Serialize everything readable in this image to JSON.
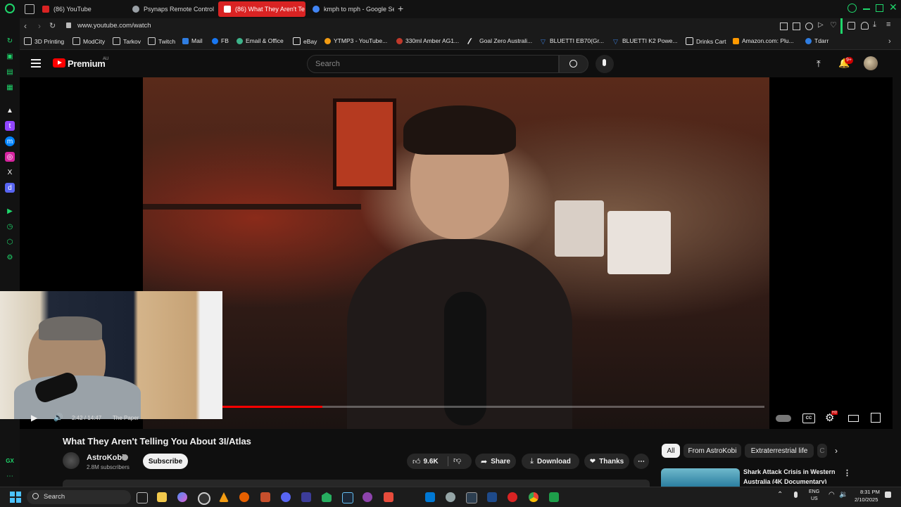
{
  "browser": {
    "tabs": [
      {
        "label": "(86) YouTube",
        "color": "#d92323"
      },
      {
        "label": "Psynaps Remote Control",
        "color": "#9aa0a6"
      },
      {
        "label": "(86) What They Aren't Te",
        "color": "#ffffff"
      },
      {
        "label": "kmph to mph - Google Se",
        "color": "#4285f4"
      }
    ],
    "new_tab": "+",
    "url": "www.youtube.com/watch",
    "bookmarks": [
      {
        "label": "3D Printing",
        "color": "#cfcfcf"
      },
      {
        "label": "ModCity",
        "color": "#cfcfcf"
      },
      {
        "label": "Tarkov",
        "color": "#cfcfcf"
      },
      {
        "label": "Twitch",
        "color": "#cfcfcf"
      },
      {
        "label": "Mail",
        "color": "#2f7de1"
      },
      {
        "label": "FB",
        "color": "#1877f2"
      },
      {
        "label": "Email & Office",
        "color": "#3db38a"
      },
      {
        "label": "eBay",
        "color": "#e6e6e6"
      },
      {
        "label": "YTMP3 - YouTube...",
        "color": "#f39c12"
      },
      {
        "label": "330ml Amber AG1...",
        "color": "#c0392b"
      },
      {
        "label": "Goal Zero Australi...",
        "color": "#e6e6e6"
      },
      {
        "label": "BLUETTI EB70(Gr...",
        "color": "#3a7bd5"
      },
      {
        "label": "BLUETTI K2 Powe...",
        "color": "#3a7bd5"
      },
      {
        "label": "Drinks Cart",
        "color": "#e6e6e6"
      },
      {
        "label": "Amazon.com: Plu...",
        "color": "#ff9900"
      },
      {
        "label": "Tdarr",
        "color": "#2f7de1"
      }
    ]
  },
  "youtube": {
    "logo": "Premium",
    "region": "AU",
    "search_placeholder": "Search",
    "notifications": "9+",
    "video_title": "What They Aren't Telling You About 3I/Atlas",
    "channel": "AstroKobi",
    "subscribers": "2.8M subscribers",
    "subscribe": "Subscribe",
    "likes": "9.6K",
    "share": "Share",
    "download": "Download",
    "thanks": "Thanks",
    "chips": [
      "All",
      "From AstroKobi",
      "Extraterrestrial life",
      "C"
    ],
    "rec_title_1": "Shark Attack Crisis in Western",
    "rec_title_2": "Australia (4K Documentary)",
    "player": {
      "time": "2:42 / 14:47",
      "chapter": "The Paper",
      "progress": 0.185,
      "hd_badge": "HD"
    }
  },
  "taskbar": {
    "search": "Search",
    "lang_1": "ENG",
    "lang_2": "US",
    "time": "8:31 PM",
    "date": "2/10/2025"
  },
  "colors": {
    "accent_green": "#1fd66b",
    "yt_red": "#ff0000",
    "tab_active": "#d92323"
  }
}
